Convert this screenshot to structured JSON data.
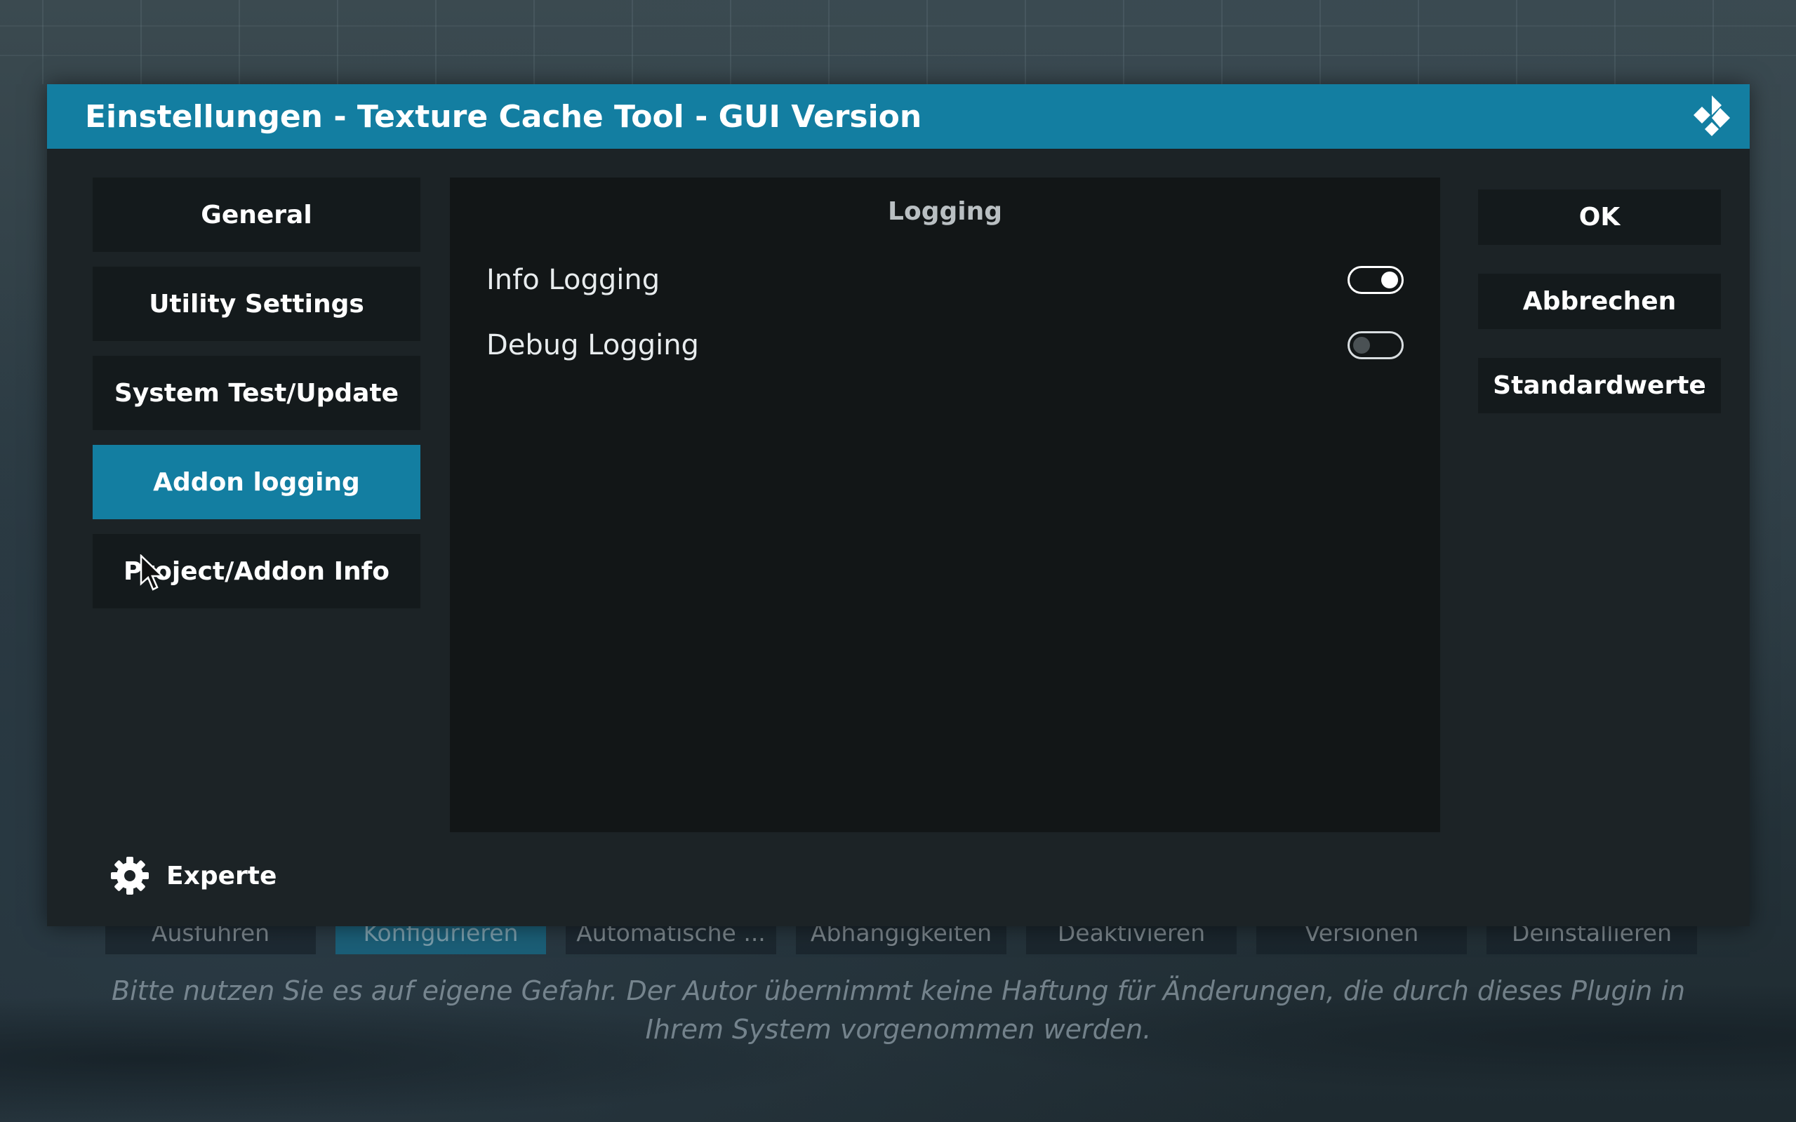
{
  "background": {
    "buttons": [
      "Ausführen",
      "Konfigurieren",
      "Automatische ...",
      "Abhängigkeiten",
      "Deaktivieren",
      "Versionen",
      "Deinstallieren"
    ],
    "active_button_index": 1,
    "disclaimer": "Bitte nutzen Sie es auf eigene Gefahr. Der Autor übernimmt keine Haftung für Änderungen, die durch dieses Plugin in Ihrem System vorgenommen werden."
  },
  "dialog": {
    "title": "Einstellungen - Texture Cache Tool - GUI Version",
    "logo_icon": "kodi-logo-icon",
    "categories": [
      {
        "label": "General",
        "active": false
      },
      {
        "label": "Utility Settings",
        "active": false
      },
      {
        "label": "System Test/Update",
        "active": false
      },
      {
        "label": "Addon logging",
        "active": true
      },
      {
        "label": "Project/Addon Info",
        "active": false
      }
    ],
    "level": {
      "icon": "gear-icon",
      "label": "Experte"
    },
    "panel": {
      "heading": "Logging",
      "settings": [
        {
          "label": "Info Logging",
          "enabled": true
        },
        {
          "label": "Debug Logging",
          "enabled": false
        }
      ]
    },
    "actions": {
      "ok": "OK",
      "cancel": "Abbrechen",
      "defaults": "Standardwerte"
    }
  },
  "colors": {
    "accent": "#137ea1",
    "button_bg": "#141a1c",
    "panel_bg": "#121617",
    "dialog_bg": "#1c2326"
  }
}
